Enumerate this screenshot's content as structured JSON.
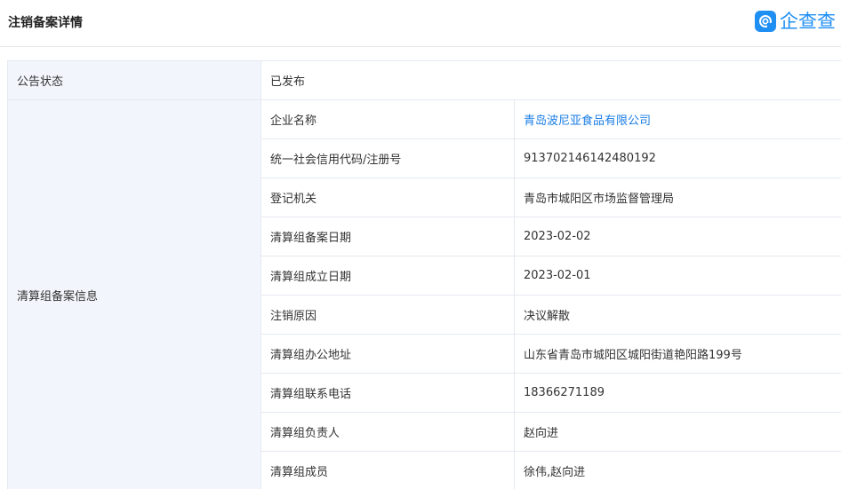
{
  "header": {
    "title": "注销备案详情",
    "logo_text": "企查查",
    "logo_color": "#1f8ff4"
  },
  "status_row": {
    "label": "公告状态",
    "value": "已发布"
  },
  "group": {
    "label": "清算组备案信息",
    "rows": [
      {
        "label": "企业名称",
        "value": "青岛波尼亚食品有限公司",
        "is_link": true
      },
      {
        "label": "统一社会信用代码/注册号",
        "value": "913702146142480192"
      },
      {
        "label": "登记机关",
        "value": "青岛市城阳区市场监督管理局"
      },
      {
        "label": "清算组备案日期",
        "value": "2023-02-02"
      },
      {
        "label": "清算组成立日期",
        "value": "2023-02-01"
      },
      {
        "label": "注销原因",
        "value": "决议解散"
      },
      {
        "label": "清算组办公地址",
        "value": "山东省青岛市城阳区城阳街道艳阳路199号"
      },
      {
        "label": "清算组联系电话",
        "value": "18366271189"
      },
      {
        "label": "清算组负责人",
        "value": "赵向进"
      },
      {
        "label": "清算组成员",
        "value": "徐伟,赵向进"
      }
    ]
  },
  "colors": {
    "label_bg": "#f2f6fc",
    "border": "#e4e9f1",
    "link": "#1a7ee6"
  }
}
